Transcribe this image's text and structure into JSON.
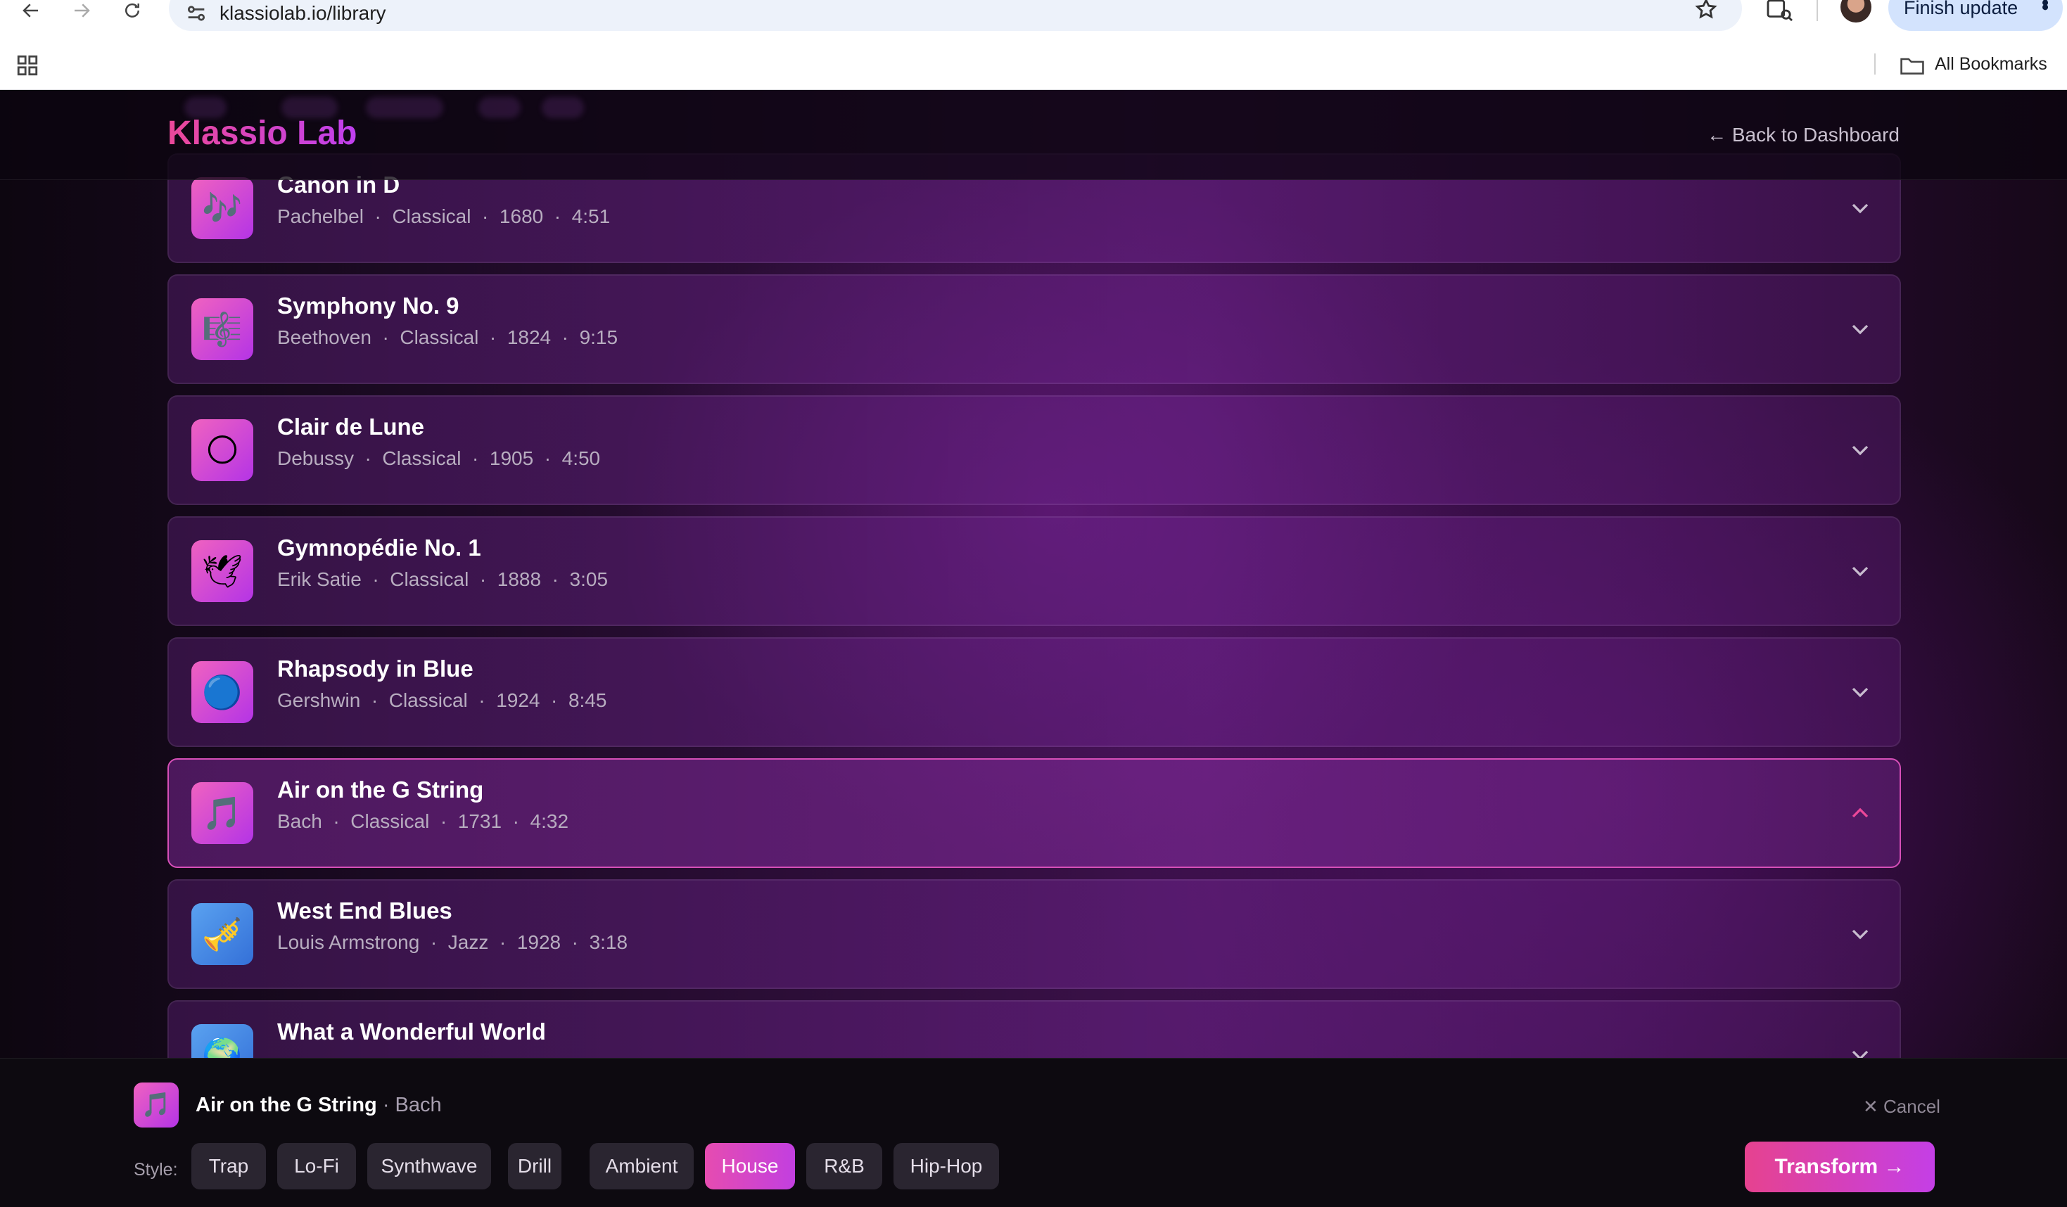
{
  "browser": {
    "url": "klassiolab.io/library",
    "finish_update": "Finish update",
    "bookmarks_label": "All Bookmarks"
  },
  "header": {
    "logo": "Klassio Lab",
    "back_link": "← Back to Dashboard"
  },
  "tracks": [
    {
      "title": "Canon in D",
      "artist": "Pachelbel",
      "genre": "Classical",
      "year": "1680",
      "duration": "4:51",
      "icon": "🎶",
      "icon_name": "musical-notes-icon",
      "selected": false
    },
    {
      "title": "Symphony No. 9",
      "artist": "Beethoven",
      "genre": "Classical",
      "year": "1824",
      "duration": "9:15",
      "icon": "🎼",
      "icon_name": "musical-score-icon",
      "selected": false
    },
    {
      "title": "Clair de Lune",
      "artist": "Debussy",
      "genre": "Classical",
      "year": "1905",
      "duration": "4:50",
      "icon": "🌕",
      "icon_name": "moon-icon",
      "selected": false
    },
    {
      "title": "Gymnopédie No. 1",
      "artist": "Erik Satie",
      "genre": "Classical",
      "year": "1888",
      "duration": "3:05",
      "icon": "🕊",
      "icon_name": "dove-icon",
      "selected": false
    },
    {
      "title": "Rhapsody in Blue",
      "artist": "Gershwin",
      "genre": "Classical",
      "year": "1924",
      "duration": "8:45",
      "icon": "🔵",
      "icon_name": "blue-circle-icon",
      "selected": false
    },
    {
      "title": "Air on the G String",
      "artist": "Bach",
      "genre": "Classical",
      "year": "1731",
      "duration": "4:32",
      "icon": "🎵",
      "icon_name": "musical-note-icon",
      "selected": true
    },
    {
      "title": "West End Blues",
      "artist": "Louis Armstrong",
      "genre": "Jazz",
      "year": "1928",
      "duration": "3:18",
      "icon": "🎺",
      "icon_name": "trumpet-icon",
      "selected": false
    },
    {
      "title": "What a Wonderful World",
      "artist": "",
      "genre": "",
      "year": "",
      "duration": "",
      "icon": "🌍",
      "icon_name": "globe-icon",
      "selected": false
    }
  ],
  "selection": {
    "title": "Air on the G String",
    "artist": "· Bach",
    "icon": "🎵",
    "cancel": "Cancel",
    "style_label": "Style:",
    "styles": [
      "Trap",
      "Lo-Fi",
      "Synthwave",
      "Drill",
      "Ambient",
      "House",
      "R&B",
      "Hip-Hop"
    ],
    "active_style": "House",
    "transform": "Transform →"
  },
  "colors": {
    "accent_pink": "#ec4899",
    "accent_purple": "#c040f0",
    "selected_border": "#d64fb8"
  }
}
